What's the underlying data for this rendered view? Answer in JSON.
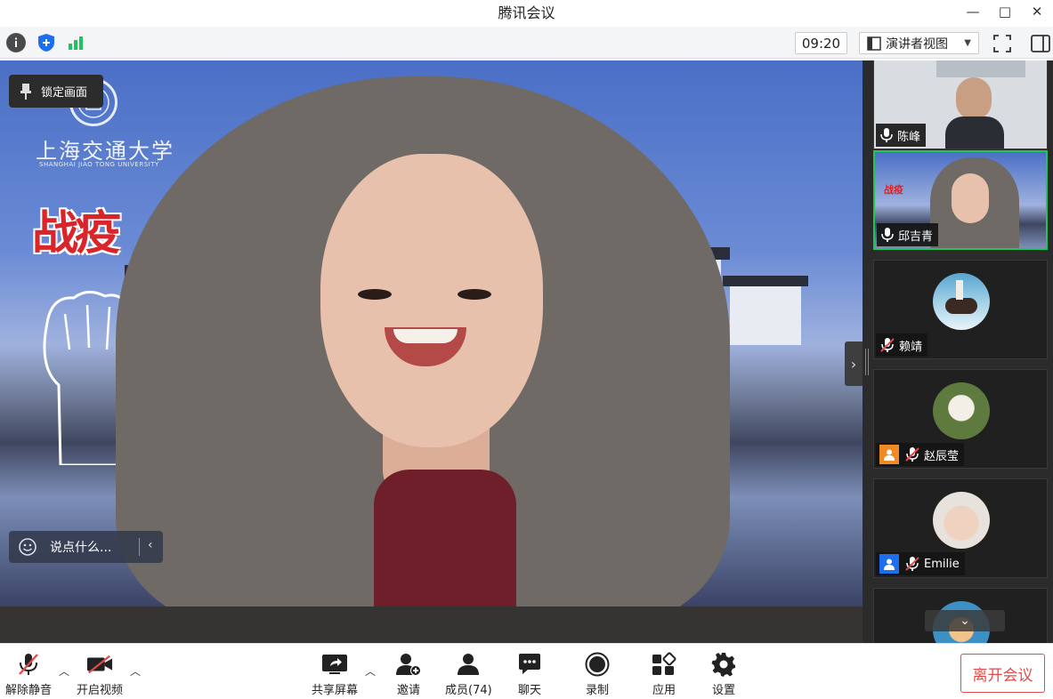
{
  "window": {
    "title": "腾讯会议",
    "controls": {
      "minimize": "—",
      "maximize": "□",
      "close": "✕"
    }
  },
  "toolbar": {
    "timer": "09:20",
    "view_mode": "演讲者视图"
  },
  "stage": {
    "lock_label": "锁定画面",
    "chat_placeholder": "说点什么...",
    "school_name": "上海交通大学",
    "school_name_en": "SHANGHAI JIAO TONG UNIVERSITY",
    "slogan": "战疫"
  },
  "gallery": {
    "participants": [
      {
        "name": "陈峰",
        "muted": false
      },
      {
        "name": "邱吉青",
        "muted": false,
        "active": true
      },
      {
        "name": "赖靖",
        "muted": true
      },
      {
        "name": "赵辰莹",
        "muted": true
      },
      {
        "name": "Emilie",
        "muted": true
      }
    ]
  },
  "bottombar": {
    "unmute": "解除静音",
    "start_video": "开启视频",
    "share_screen": "共享屏幕",
    "invite": "邀请",
    "members": "成员(74)",
    "chat": "聊天",
    "record": "录制",
    "apps": "应用",
    "settings": "设置",
    "leave": "离开会议"
  },
  "colors": {
    "accent_green": "#1fc45b",
    "leave_red": "#e24b4b",
    "stage_bg": "#363432",
    "gallery_bg": "#2b2b2b"
  }
}
